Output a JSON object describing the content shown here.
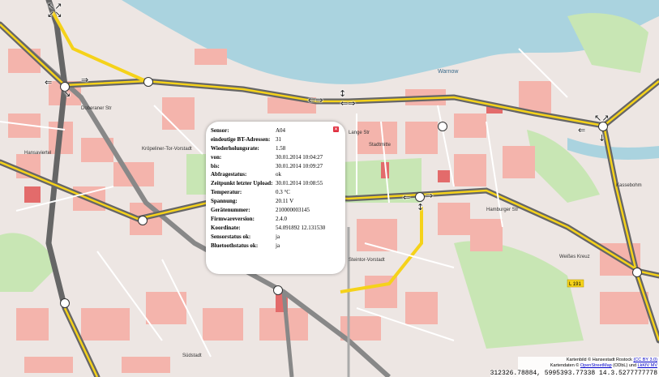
{
  "map": {
    "colors": {
      "water": "#aad3df",
      "land": "#f2efe9",
      "residential": "#e0dfdf",
      "buildings": "#f0a0a0",
      "park": "#c8e6b4",
      "motorway": "#7a7a7a",
      "highlight": "#f5d21a",
      "railway": "#888888"
    },
    "labels": [
      "Kröpeliner-Tor-Vorstadt",
      "Hansaviertel",
      "Südstadt",
      "Stadtmitte",
      "Steintor-Vorstadt",
      "Kassebohm",
      "Lange Str",
      "Hamburger Str",
      "Doberaner Str",
      "Warnow",
      "L 191",
      "Weißes Kreuz"
    ]
  },
  "popup": {
    "close_icon": "close-icon",
    "rows": [
      {
        "key": "Sensor:",
        "value": "A04"
      },
      {
        "key": "eindeutige BT-Adressen:",
        "value": "31"
      },
      {
        "key": "Wiederholungsrate:",
        "value": "1.58"
      },
      {
        "key": "von:",
        "value": "30.01.2014 10:04:27"
      },
      {
        "key": "bis:",
        "value": "30.01.2014 10:09:27"
      },
      {
        "key": "Abfragestatus:",
        "value": "ok"
      },
      {
        "key": "Zeitpunkt letzter Upload:",
        "value": "30.01.2014 10:08:55"
      },
      {
        "key": "Temperatur:",
        "value": "0.3 °C"
      },
      {
        "key": "Spannung:",
        "value": "20.11 V"
      },
      {
        "key": "Gerätenummer:",
        "value": "210000003145"
      },
      {
        "key": "Firmwareversion:",
        "value": "2.4.0"
      },
      {
        "key": "Koordinate:",
        "value": "54.091892 12.131530"
      },
      {
        "key": "Sensorstatus ok:",
        "value": "ja"
      },
      {
        "key": "Bluetoothstatus ok:",
        "value": "ja"
      }
    ]
  },
  "attribution": {
    "line1_prefix": "Kartenbild © Hansestadt Rostock",
    "line1_link": "(CC BY 3.0)",
    "line2_prefix": "Kartendaten ©",
    "line2_link1": "OpenStreetMap",
    "line2_mid": "(ODbL) und",
    "line2_link2": "LkKfV MV"
  },
  "coordinates": "312326.78884, 5995393.77338 14.3.5277777778"
}
